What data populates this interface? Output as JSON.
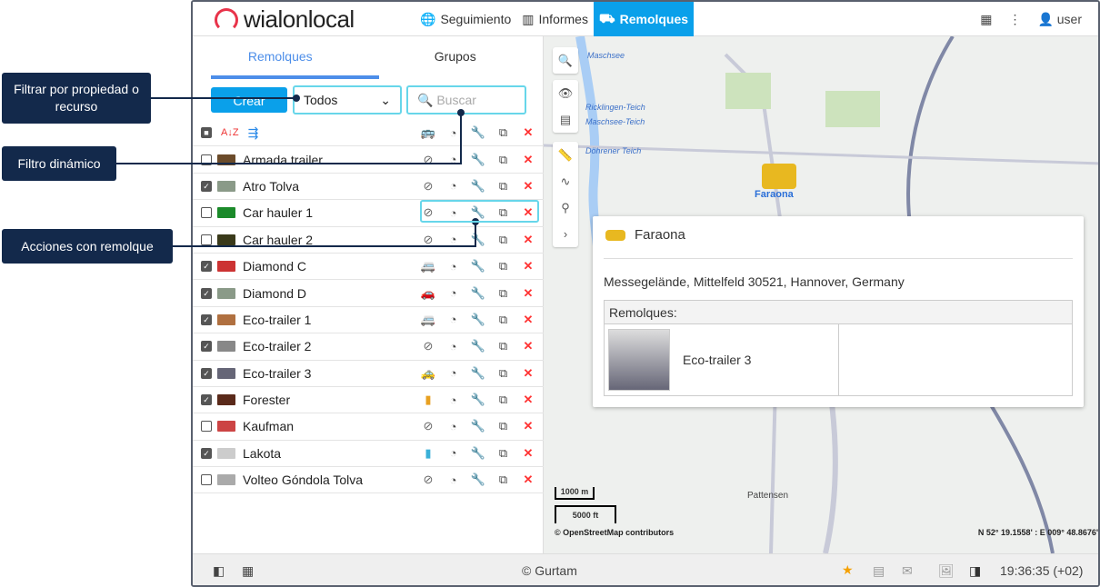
{
  "header": {
    "logo": "wialonlocal",
    "nav": [
      {
        "label": "Seguimiento",
        "icon": "globe-icon"
      },
      {
        "label": "Informes",
        "icon": "report-icon"
      },
      {
        "label": "Remolques",
        "icon": "trailer-icon"
      }
    ],
    "user": "user"
  },
  "panel": {
    "tabs": [
      "Remolques",
      "Grupos"
    ],
    "create_label": "Crear",
    "filter_value": "Todos",
    "search_placeholder": "Buscar"
  },
  "rows": [
    {
      "name": "Armada trailer",
      "checked": false,
      "thumb": "#6b4b2a",
      "unit": "link"
    },
    {
      "name": "Atro Tolva",
      "checked": true,
      "thumb": "#8a9a88",
      "unit": "link"
    },
    {
      "name": "Car hauler 1",
      "checked": false,
      "thumb": "#1b8a2a",
      "unit": "link"
    },
    {
      "name": "Car hauler 2",
      "checked": false,
      "thumb": "#3a3a1a",
      "unit": "link"
    },
    {
      "name": "Diamond C",
      "checked": true,
      "thumb": "#c33",
      "unit": "van"
    },
    {
      "name": "Diamond D",
      "checked": true,
      "thumb": "#8a9a88",
      "unit": "car-blue"
    },
    {
      "name": "Eco-trailer 1",
      "checked": true,
      "thumb": "#b07040",
      "unit": "van"
    },
    {
      "name": "Eco-trailer 2",
      "checked": true,
      "thumb": "#888",
      "unit": "link"
    },
    {
      "name": "Eco-trailer 3",
      "checked": true,
      "thumb": "#667",
      "unit": "car-yellow"
    },
    {
      "name": "Forester",
      "checked": true,
      "thumb": "#5a2a1a",
      "unit": "car-top"
    },
    {
      "name": "Kaufman",
      "checked": false,
      "thumb": "#c44",
      "unit": "link"
    },
    {
      "name": "Lakota",
      "checked": true,
      "thumb": "#ccc",
      "unit": "car-cyan"
    },
    {
      "name": "Volteo Góndola Tolva",
      "checked": false,
      "thumb": "#aaa",
      "unit": "link"
    }
  ],
  "map": {
    "unit_label": "Faraona",
    "scale_m": "1000 m",
    "scale_ft": "5000 ft",
    "attribution": "© OpenStreetMap contributors",
    "coords": "N 52° 19.1558' : E 009° 48.8676'",
    "places": [
      "Maschsee",
      "Ricklingen-Teich",
      "Maschsee-Teich",
      "Döhrener Teich",
      "Pattensen"
    ]
  },
  "popup": {
    "title": "Faraona",
    "address": "Messegelände, Mittelfeld 30521, Hannover, Germany",
    "section": "Remolques:",
    "trailer": "Eco-trailer 3"
  },
  "footer": {
    "copyright": "© Gurtam",
    "time": "19:36:35 (+02)"
  },
  "callouts": [
    "Filtrar por propiedad o recurso",
    "Filtro dinámico",
    "Acciones con remolque"
  ],
  "colors": {
    "accent": "#0aa0ea",
    "callout": "#13294b",
    "delete": "#ff3333"
  }
}
